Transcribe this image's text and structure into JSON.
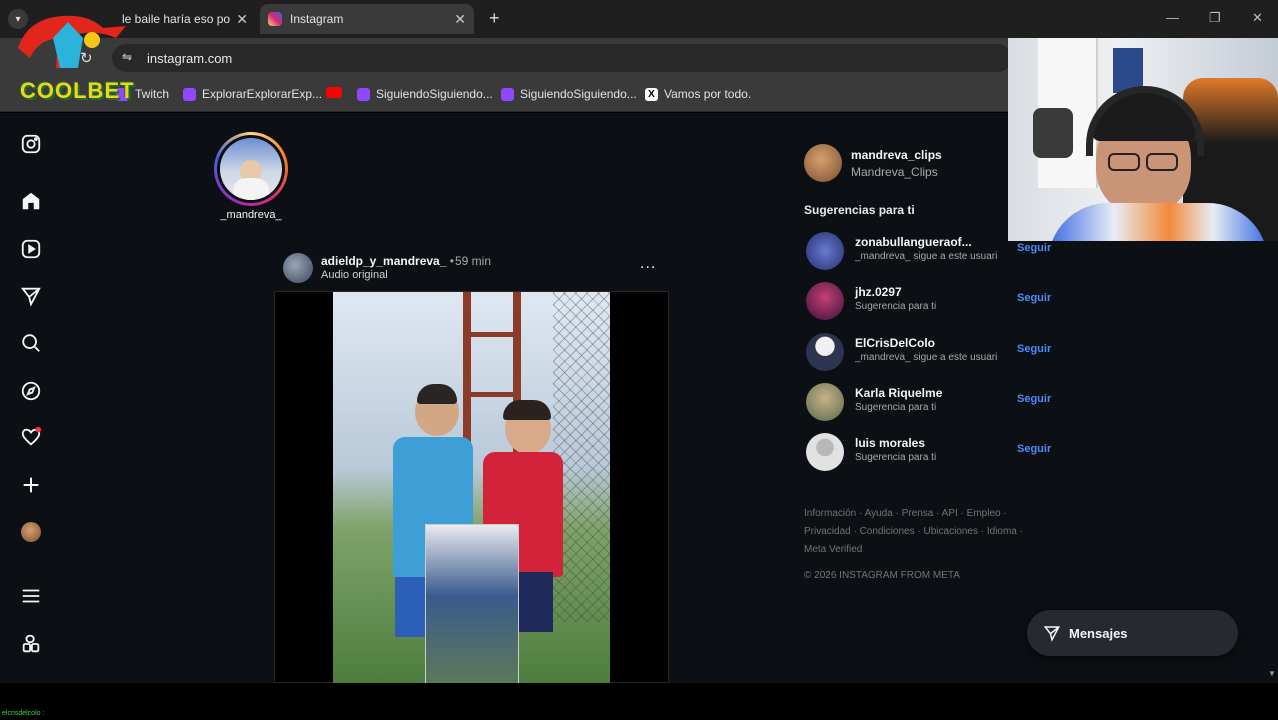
{
  "browser": {
    "tabs": [
      {
        "title": "le baile haría eso po",
        "active": false
      },
      {
        "title": "Instagram",
        "active": true
      }
    ],
    "new_tab_label": "+",
    "url": "instagram.com",
    "bookmarks": [
      {
        "label": "Twitch",
        "icon": "twitch-icon"
      },
      {
        "label": "ExplorarExplorarExp...",
        "icon": "twitch-icon"
      },
      {
        "label": "",
        "icon": "youtube-icon"
      },
      {
        "label": "SiguiendoSiguiendo...",
        "icon": "twitch-icon"
      },
      {
        "label": "SiguiendoSiguiendo...",
        "icon": "twitch-icon"
      },
      {
        "label": "Vamos por todo.",
        "icon": "x-icon"
      }
    ]
  },
  "overlay": {
    "logo_text": "COOLBET",
    "chat_user": "elcrisdelcolo :"
  },
  "instagram": {
    "nav": [
      "instagram-icon",
      "home-icon",
      "reels-icon",
      "direct-icon",
      "search-icon",
      "explore-icon",
      "notifications-icon",
      "create-icon",
      "profile-icon",
      "more-menu-icon",
      "threads-icon"
    ],
    "story": {
      "username": "_mandreva_"
    },
    "post": {
      "username": "adieldp_y_mandreva_",
      "separator": "•",
      "time": "59 min",
      "audio": "Audio original",
      "more": "..."
    },
    "current_user": {
      "username": "mandreva_clips",
      "display_name": "Mandreva_Clips"
    },
    "suggestions_title": "Sugerencias para ti",
    "suggestions": [
      {
        "username": "zonabullangueraof...",
        "subtitle": "_mandreva_ sigue a este usuari",
        "follow": "Seguir"
      },
      {
        "username": "jhz.0297",
        "subtitle": "Sugerencia para ti",
        "follow": "Seguir"
      },
      {
        "username": "ElCrisDelColo",
        "subtitle": "_mandreva_ sigue a este usuari",
        "follow": "Seguir"
      },
      {
        "username": "Karla Riquelme",
        "subtitle": "Sugerencia para ti",
        "follow": "Seguir"
      },
      {
        "username": "luis morales",
        "subtitle": "Sugerencia para ti",
        "follow": "Seguir"
      }
    ],
    "footer_links": "Información · Ayuda · Prensa · API · Empleo · Privacidad · Condiciones · Ubicaciones · Idioma · Meta Verified",
    "copyright": "© 2026 INSTAGRAM FROM META",
    "messages_label": "Mensajes"
  },
  "colors": {
    "ig_bg": "#0c1014",
    "follow": "#4a8cf7",
    "chrome_toolbar": "#3a3a3a"
  }
}
